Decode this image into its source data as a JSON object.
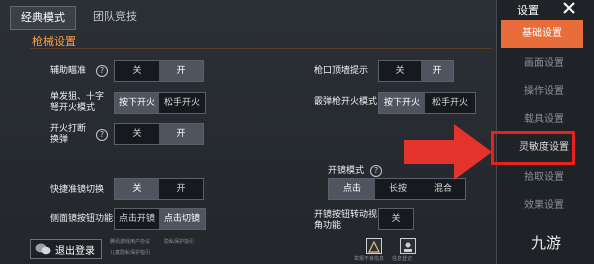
{
  "tabs": [
    "经典模式",
    "团队竞技"
  ],
  "section_title": "枪械设置",
  "rows": {
    "aim_assist": {
      "label": "辅助瞄准",
      "options": [
        "关",
        "开"
      ]
    },
    "muzzle_hint": {
      "label": "枪口顶墙提示",
      "options": [
        "关",
        "开"
      ]
    },
    "single_fire": {
      "label": "单发狙、十字弩开火模式",
      "options": [
        "按下开火",
        "松手开火"
      ]
    },
    "scope_fire": {
      "label": "霰弹枪开火模式",
      "options": [
        "按下开火",
        "松手开火"
      ]
    },
    "interrupt_reload": {
      "label": "开火打断换弹",
      "options": [
        "关",
        "开"
      ]
    },
    "scope_mode": {
      "label": "开镜模式",
      "options": [
        "点击",
        "长按",
        "混合"
      ]
    },
    "quick_switch": {
      "label": "快捷准镜切换",
      "options": [
        "关",
        "开"
      ]
    },
    "side_scope": {
      "label": "侧面镜按钮功能",
      "options": [
        "点击开镜",
        "点击切镜"
      ]
    },
    "scope_turn": {
      "label": "开镜按钮转动视角功能",
      "options": [
        "关"
      ]
    }
  },
  "login_button": "退出登录",
  "bottom_small": [
    "腾讯游戏用户协议",
    "隐私保护指引",
    "儿童隐私保护指引"
  ],
  "bottom_icons": [
    "举报不良信息",
    "信息登记"
  ],
  "sidebar": {
    "title": "设置",
    "items": [
      "基础设置",
      "画面设置",
      "操作设置",
      "载具设置",
      "灵敏度设置",
      "拾取设置",
      "效果设置"
    ],
    "active_index": 0
  },
  "watermark": "九游",
  "colors": {
    "accent": "#e96d3a",
    "highlight": "#e8211d",
    "arrow": "#e3332b"
  }
}
